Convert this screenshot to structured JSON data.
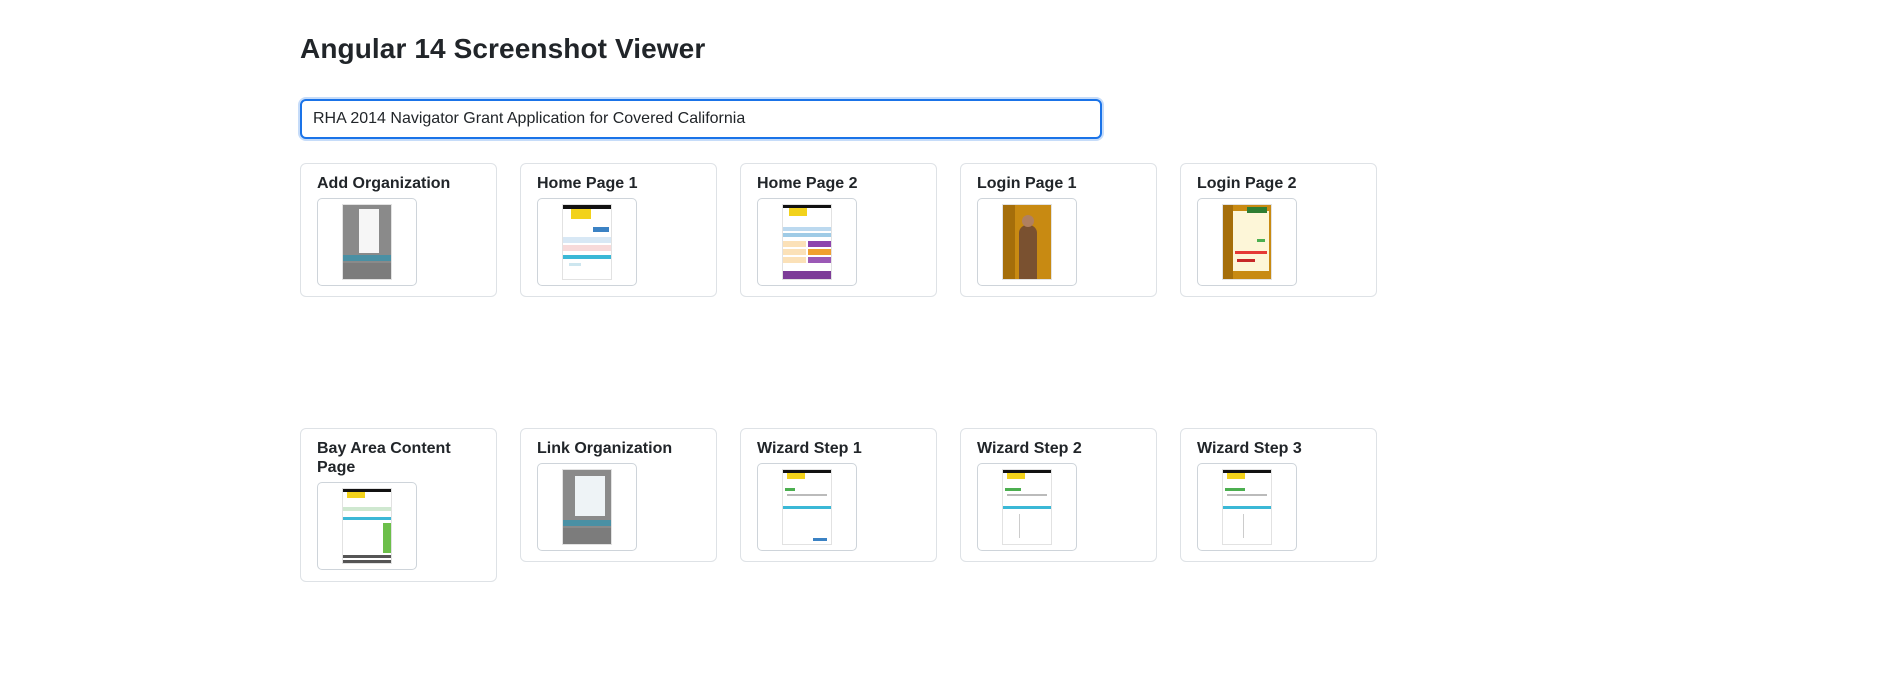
{
  "page": {
    "title": "Angular 14 Screenshot Viewer"
  },
  "search": {
    "value": "RHA 2014 Navigator Grant Application for Covered California"
  },
  "cards": [
    {
      "title": "Add Organization",
      "thumbnail": "add-organization-screenshot"
    },
    {
      "title": "Home Page 1",
      "thumbnail": "home-page-1-screenshot"
    },
    {
      "title": "Home Page 2",
      "thumbnail": "home-page-2-screenshot"
    },
    {
      "title": "Login Page 1",
      "thumbnail": "login-page-1-screenshot"
    },
    {
      "title": "Login Page 2",
      "thumbnail": "login-page-2-screenshot"
    },
    {
      "title": "Bay Area Content Page",
      "thumbnail": "bay-area-content-page-screenshot"
    },
    {
      "title": "Link Organization",
      "thumbnail": "link-organization-screenshot"
    },
    {
      "title": "Wizard Step 1",
      "thumbnail": "wizard-step-1-screenshot"
    },
    {
      "title": "Wizard Step 2",
      "thumbnail": "wizard-step-2-screenshot"
    },
    {
      "title": "Wizard Step 3",
      "thumbnail": "wizard-step-3-screenshot"
    }
  ],
  "colors": {
    "focus_border": "#1a73e8",
    "card_border": "#dee2e6",
    "text": "#212529"
  }
}
